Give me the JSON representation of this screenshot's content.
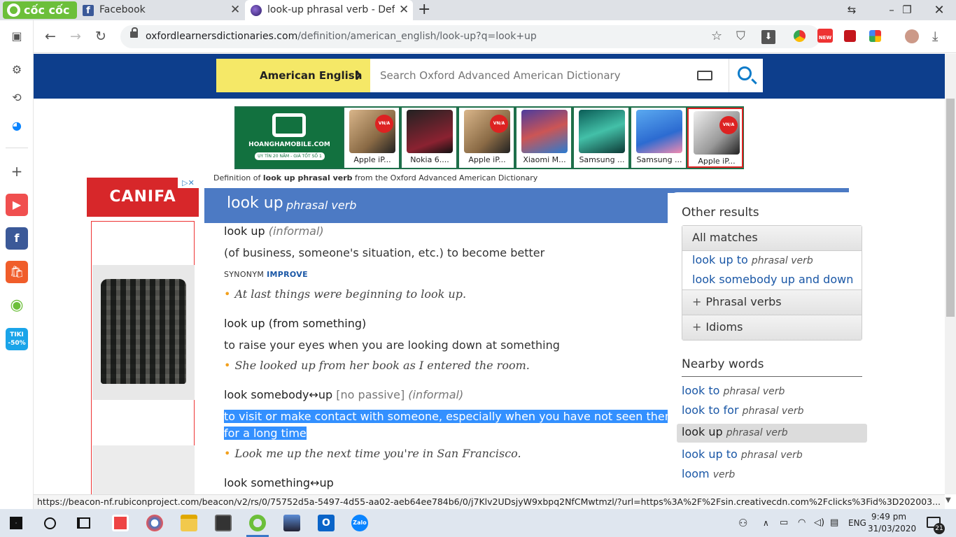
{
  "browser": {
    "brand": "cốc cốc",
    "tabs": [
      {
        "title": "Facebook",
        "favicon": "facebook-icon",
        "color": "#3b5998"
      },
      {
        "title": "look-up phrasal verb - Definit",
        "favicon": "oxford-icon",
        "color": "#3f2b86"
      }
    ],
    "url_domain": "oxfordlearnersdictionaries.com",
    "url_path": "/definition/american_english/look-up?q=look+up",
    "ext_new_badge": "NEW",
    "status_url": "https://beacon-nf.rubiconproject.com/beacon/v2/rs/0/75752d5a-5497-4d55-aa02-aeb64ee784b6/0/j7Klv2UDsjyW9xbpq2NfCMwtmzl/?url=https%3A%2F%2Fsin.creativecdn.com%2Fclicks%3Fid%3D202003..."
  },
  "sidebar": {
    "tiki_label": "TIKI",
    "tiki_discount": "-50%"
  },
  "header": {
    "language": "American English",
    "search_placeholder": "Search Oxford Advanced American Dictionary"
  },
  "ad_banner": {
    "brand": "HOANGHAMOBILE.COM",
    "tagline": "UY TÍN 20 NĂM - GIÁ TỐT SỐ 1",
    "badge": "VN/A",
    "products": [
      "Apple iP...",
      "Nokia 6....",
      "Apple iP...",
      "Xiaomi M...",
      "Samsung ...",
      "Samsung ...",
      "Apple iP..."
    ]
  },
  "left_ad": {
    "brand": "CANIFA",
    "choice": "▷✕"
  },
  "entry": {
    "definition_prefix": "Definition of ",
    "definition_word": "look up phrasal verb",
    "definition_suffix": " from the Oxford Advanced American Dictionary",
    "headword": "look up",
    "pos": "phrasal verb",
    "senses": [
      {
        "hw": "look up",
        "labels": "(informal)",
        "def": "(of business, someone's situation, etc.) to become better",
        "synonym_label": "SYNONYM",
        "synonym": "IMPROVE",
        "example": "At last things were beginning to look up."
      },
      {
        "hw": "look up (from something)",
        "def": "to raise your eyes when you are looking down at something",
        "example": "She looked up from her book as I entered the room."
      },
      {
        "hw": "look somebody↔up",
        "gram": "[no passive]",
        "labels": "(informal)",
        "def_line1": "to visit or make contact with someone, especially when you have not seen them",
        "def_line2": "for a long time",
        "example": "Look me up the next time you're in San Francisco."
      },
      {
        "hw": "look something↔up"
      }
    ]
  },
  "right_panel": {
    "other_results_title": "Other results",
    "all_matches": "All matches",
    "matches": [
      {
        "word": "look up to",
        "pos": "phrasal verb"
      },
      {
        "word": "look somebody up and down",
        "pos": ""
      }
    ],
    "phrasal_verbs": "Phrasal verbs",
    "idioms": "Idioms",
    "nearby_title": "Nearby words",
    "nearby": [
      {
        "word": "look to",
        "pos": "phrasal verb"
      },
      {
        "word": "look to for",
        "pos": "phrasal verb"
      },
      {
        "word": "look up",
        "pos": "phrasal verb"
      },
      {
        "word": "look up to",
        "pos": "phrasal verb"
      },
      {
        "word": "loom",
        "pos": "verb"
      }
    ]
  },
  "taskbar": {
    "language": "ENG",
    "time": "9:49 pm",
    "date": "31/03/2020",
    "notifications": "21"
  },
  "colors": {
    "header_blue": "#0d3e8c",
    "entry_blue": "#4c7ac4",
    "lang_yellow": "#f5e867",
    "link_blue": "#1a57a6",
    "selection": "#3390ff"
  }
}
